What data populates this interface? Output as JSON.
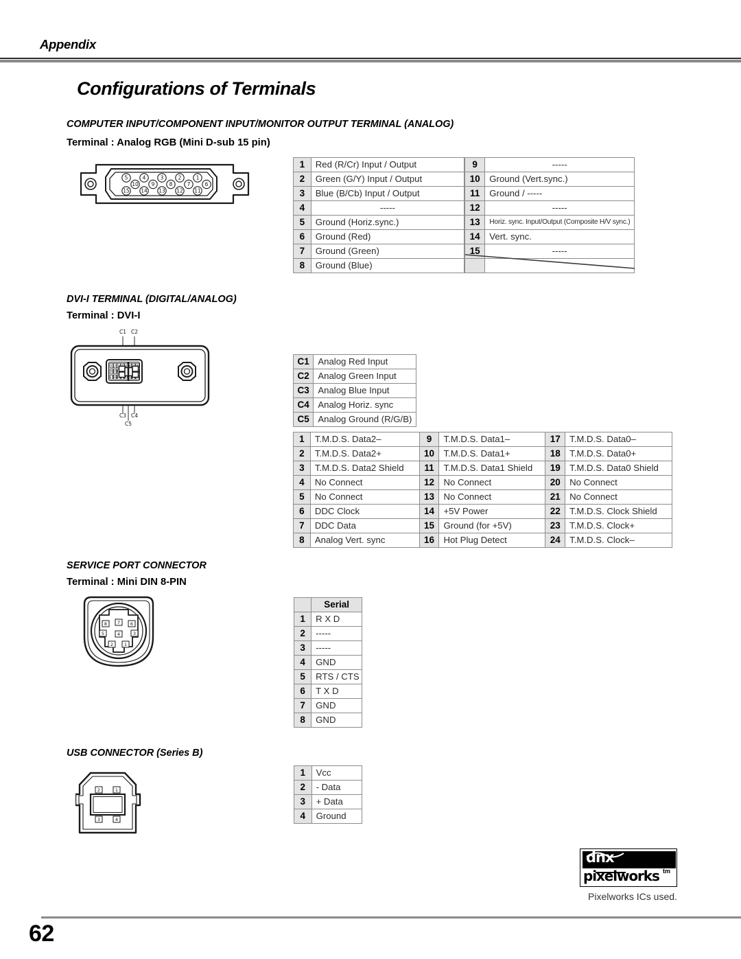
{
  "running_head": {
    "label": "Appendix"
  },
  "page_title": "Configurations of Terminals",
  "footer": {
    "page_number": "62"
  },
  "logo": {
    "mark_top": "dnx",
    "mark_bottom": "pixelworks",
    "trademark": "tm",
    "caption": "Pixelworks ICs used."
  },
  "sections": {
    "analog": {
      "heading": "COMPUTER INPUT/COMPONENT INPUT/MONITOR OUTPUT TERMINAL (ANALOG)",
      "terminal": "Terminal : Analog RGB (Mini D-sub 15 pin)",
      "connector": {
        "name": "mini-d-sub-15",
        "rows": [
          [
            "5",
            "4",
            "3",
            "2",
            "1"
          ],
          [
            "10",
            "9",
            "8",
            "7",
            "6"
          ],
          [
            "15",
            "14",
            "13",
            "12",
            "11"
          ]
        ]
      },
      "table": {
        "left": [
          {
            "pin": "1",
            "desc": "Red (R/Cr) Input / Output",
            "center": false
          },
          {
            "pin": "2",
            "desc": "Green (G/Y) Input / Output",
            "center": false
          },
          {
            "pin": "3",
            "desc": "Blue (B/Cb) Input / Output",
            "center": false
          },
          {
            "pin": "4",
            "desc": "-----",
            "center": true
          },
          {
            "pin": "5",
            "desc": "Ground (Horiz.sync.)",
            "center": false
          },
          {
            "pin": "6",
            "desc": "Ground (Red)",
            "center": false
          },
          {
            "pin": "7",
            "desc": "Ground (Green)",
            "center": false
          },
          {
            "pin": "8",
            "desc": "Ground (Blue)",
            "center": false
          }
        ],
        "right": [
          {
            "pin": "9",
            "desc": "-----",
            "center": true,
            "tiny": false
          },
          {
            "pin": "10",
            "desc": "Ground (Vert.sync.)",
            "center": false,
            "tiny": false
          },
          {
            "pin": "11",
            "desc": "Ground / -----",
            "center": false,
            "tiny": false
          },
          {
            "pin": "12",
            "desc": "-----",
            "center": true,
            "tiny": false
          },
          {
            "pin": "13",
            "desc": "Horiz. sync. Input/Output (Composite H/V sync.)",
            "center": false,
            "tiny": true
          },
          {
            "pin": "14",
            "desc": "Vert. sync.",
            "center": false,
            "tiny": false
          },
          {
            "pin": "15",
            "desc": "-----",
            "center": true,
            "tiny": false
          },
          {
            "pin": "",
            "desc": "",
            "center": false,
            "tiny": false,
            "struck": true
          }
        ]
      }
    },
    "dvi": {
      "heading": "DVI-I TERMINAL (DIGITAL/ANALOG)",
      "terminal": "Terminal : DVI-I",
      "connector": {
        "name": "dvi-i",
        "rows": [
          [
            "1",
            "2",
            "3",
            "4",
            "5",
            "6",
            "7",
            "8"
          ],
          [
            "9",
            "10",
            "11",
            "12",
            "13",
            "14",
            "15",
            "16"
          ],
          [
            "17",
            "18",
            "19",
            "20",
            "21",
            "22",
            "23",
            "24"
          ]
        ],
        "cross_labels_top": [
          "C1",
          "C2"
        ],
        "cross_labels_bottom": [
          "C3",
          "C4"
        ],
        "cross_label_blade": "C5"
      },
      "analog_table": [
        {
          "pin": "C1",
          "desc": "Analog Red Input"
        },
        {
          "pin": "C2",
          "desc": "Analog Green Input"
        },
        {
          "pin": "C3",
          "desc": "Analog Blue Input"
        },
        {
          "pin": "C4",
          "desc": "Analog Horiz. sync"
        },
        {
          "pin": "C5",
          "desc": "Analog Ground (R/G/B)"
        }
      ],
      "digital_table": {
        "col1": [
          {
            "pin": "1",
            "desc": "T.M.D.S. Data2–"
          },
          {
            "pin": "2",
            "desc": "T.M.D.S. Data2+"
          },
          {
            "pin": "3",
            "desc": "T.M.D.S. Data2 Shield"
          },
          {
            "pin": "4",
            "desc": "No Connect"
          },
          {
            "pin": "5",
            "desc": "No Connect"
          },
          {
            "pin": "6",
            "desc": "DDC Clock"
          },
          {
            "pin": "7",
            "desc": "DDC Data"
          },
          {
            "pin": "8",
            "desc": "Analog Vert. sync"
          }
        ],
        "col2": [
          {
            "pin": "9",
            "desc": "T.M.D.S. Data1–"
          },
          {
            "pin": "10",
            "desc": "T.M.D.S. Data1+"
          },
          {
            "pin": "11",
            "desc": "T.M.D.S. Data1 Shield"
          },
          {
            "pin": "12",
            "desc": "No Connect"
          },
          {
            "pin": "13",
            "desc": "No Connect"
          },
          {
            "pin": "14",
            "desc": "+5V Power"
          },
          {
            "pin": "15",
            "desc": "Ground (for +5V)"
          },
          {
            "pin": "16",
            "desc": "Hot Plug Detect"
          }
        ],
        "col3": [
          {
            "pin": "17",
            "desc": "T.M.D.S. Data0–"
          },
          {
            "pin": "18",
            "desc": "T.M.D.S. Data0+"
          },
          {
            "pin": "19",
            "desc": "T.M.D.S. Data0 Shield"
          },
          {
            "pin": "20",
            "desc": "No Connect"
          },
          {
            "pin": "21",
            "desc": "No Connect"
          },
          {
            "pin": "22",
            "desc": "T.M.D.S. Clock Shield"
          },
          {
            "pin": "23",
            "desc": "T.M.D.S. Clock+"
          },
          {
            "pin": "24",
            "desc": "T.M.D.S. Clock–"
          }
        ]
      }
    },
    "service": {
      "heading": "SERVICE PORT CONNECTOR",
      "terminal": "Terminal : Mini DIN 8-PIN",
      "connector": {
        "name": "mini-din-8",
        "rows": [
          [
            "8",
            "7",
            "6"
          ],
          [
            "5",
            "4",
            "3"
          ],
          [
            "2",
            "1"
          ]
        ]
      },
      "table": {
        "header": "Serial",
        "rows": [
          {
            "pin": "1",
            "desc": "R X D"
          },
          {
            "pin": "2",
            "desc": "-----"
          },
          {
            "pin": "3",
            "desc": "-----"
          },
          {
            "pin": "4",
            "desc": "GND"
          },
          {
            "pin": "5",
            "desc": "RTS / CTS"
          },
          {
            "pin": "6",
            "desc": "T X D"
          },
          {
            "pin": "7",
            "desc": "GND"
          },
          {
            "pin": "8",
            "desc": "GND"
          }
        ]
      }
    },
    "usb": {
      "heading": "USB CONNECTOR (Series B)",
      "connector": {
        "name": "usb-series-b",
        "top_pins": [
          "2",
          "1"
        ],
        "bottom_pins": [
          "3",
          "4"
        ]
      },
      "table": [
        {
          "pin": "1",
          "desc": "Vcc"
        },
        {
          "pin": "2",
          "desc": "- Data"
        },
        {
          "pin": "3",
          "desc": "+ Data"
        },
        {
          "pin": "4",
          "desc": "Ground"
        }
      ]
    }
  }
}
